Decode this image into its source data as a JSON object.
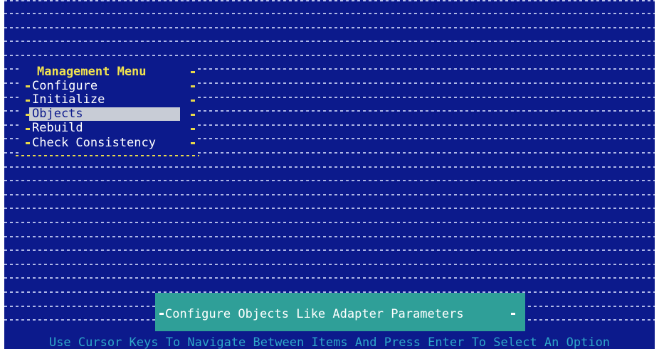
{
  "menu": {
    "title": "Management Menu",
    "items": [
      {
        "label": "Configure",
        "selected": false
      },
      {
        "label": "Initialize",
        "selected": false
      },
      {
        "label": "Objects",
        "selected": true
      },
      {
        "label": "Rebuild",
        "selected": false
      },
      {
        "label": "Check Consistency",
        "selected": false
      }
    ]
  },
  "status": {
    "description": "Configure Objects Like Adapter Parameters"
  },
  "hint": {
    "text": "Use Cursor Keys To Navigate Between Items And Press Enter To Select An Option"
  },
  "colors": {
    "background": "#0c1a8c",
    "menu_title": "#f2e34e",
    "selection": "#c8ccd6",
    "status_box": "#2f9f98",
    "hint_text": "#2ea6c8"
  }
}
